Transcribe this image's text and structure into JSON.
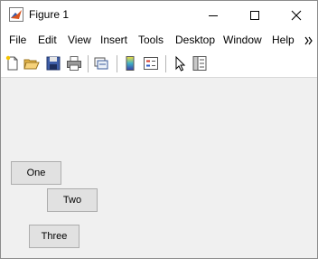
{
  "window": {
    "title": "Figure 1",
    "controls": [
      "minimize-icon",
      "maximize-icon",
      "close-icon"
    ]
  },
  "menubar": {
    "items": [
      "File",
      "Edit",
      "View",
      "Insert",
      "Tools",
      "Desktop",
      "Window",
      "Help"
    ],
    "overflow_icon": "chevron-double-right-icon"
  },
  "toolbar": {
    "icons": [
      "new-figure-icon",
      "open-file-icon",
      "save-icon",
      "print-icon",
      "link-plot-icon",
      "insert-colorbar-icon",
      "insert-legend-icon",
      "edit-plot-pointer-icon",
      "property-inspector-icon"
    ]
  },
  "buttons": {
    "one": "One",
    "two": "Two",
    "three": "Three"
  },
  "colors": {
    "figure_background": "#f0f0f0",
    "button_face": "#e1e1e1",
    "button_border": "#adadad"
  }
}
